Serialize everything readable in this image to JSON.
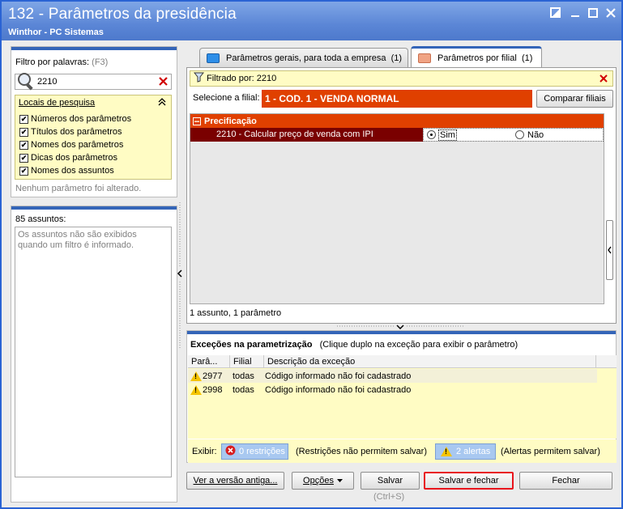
{
  "window": {
    "title": "132 - Parâmetros da presidência",
    "subtitle": "Winthor - PC Sistemas"
  },
  "filter": {
    "label": "Filtro por palavras:",
    "hotkey": "(F3)",
    "search_value": "2210",
    "locais_title": "Locais de pesquisa",
    "options": [
      {
        "label": "Números dos parâmetros",
        "checked": true
      },
      {
        "label": "Títulos dos parâmetros",
        "checked": true
      },
      {
        "label": "Nomes dos parâmetros",
        "checked": true
      },
      {
        "label": "Dicas dos parâmetros",
        "checked": true
      },
      {
        "label": "Nomes dos assuntos",
        "checked": true
      }
    ],
    "status": "Nenhum parâmetro foi alterado."
  },
  "assuntos": {
    "count_label": "85 assuntos:",
    "info": "Os assuntos não são exibidos quando um filtro é informado."
  },
  "tabs": [
    {
      "label": "Parâmetros gerais, para toda a empresa",
      "count": "(1)",
      "active": false
    },
    {
      "label": "Parâmetros por filial",
      "count": "(1)",
      "active": true
    }
  ],
  "main": {
    "filter_text": "Filtrado por: 2210",
    "filial_label": "Selecione a filial:",
    "filial_value": "1 - COD. 1 - VENDA NORMAL",
    "compare_button": "Comparar filiais",
    "category": "Precificação",
    "param_label": "2210 - Calcular preço de venda com IPI",
    "option_yes": "Sim",
    "option_no": "Não",
    "selected": "Sim",
    "summary": "1 assunto, 1 parâmetro"
  },
  "exceptions": {
    "title": "Exceções na parametrização",
    "hint": "(Clique duplo na exceção para exibir o parâmetro)",
    "columns": [
      "Parâ...",
      "Filial",
      "Descrição da exceção"
    ],
    "rows": [
      {
        "param": "2977",
        "filial": "todas",
        "desc": "Código informado não foi cadastrado"
      },
      {
        "param": "2998",
        "filial": "todas",
        "desc": "Código informado não foi cadastrado"
      }
    ],
    "show_label": "Exibir:",
    "restrictions_button": "0 restrições",
    "restrictions_note": "(Restrições não permitem salvar)",
    "alerts_button": "2 alertas",
    "alerts_note": "(Alertas permitem salvar)"
  },
  "bottom": {
    "old_version": "Ver a versão antiga...",
    "options": "Opções",
    "save": "Salvar",
    "save_hotkey": "(Ctrl+S)",
    "save_close": "Salvar e fechar",
    "close": "Fechar"
  },
  "colors": {
    "accent": "#3465b8",
    "filial": "#e04000",
    "param_row": "#7a0000",
    "highlight_border": "#e8141c",
    "info_bg": "#fffcc4"
  }
}
